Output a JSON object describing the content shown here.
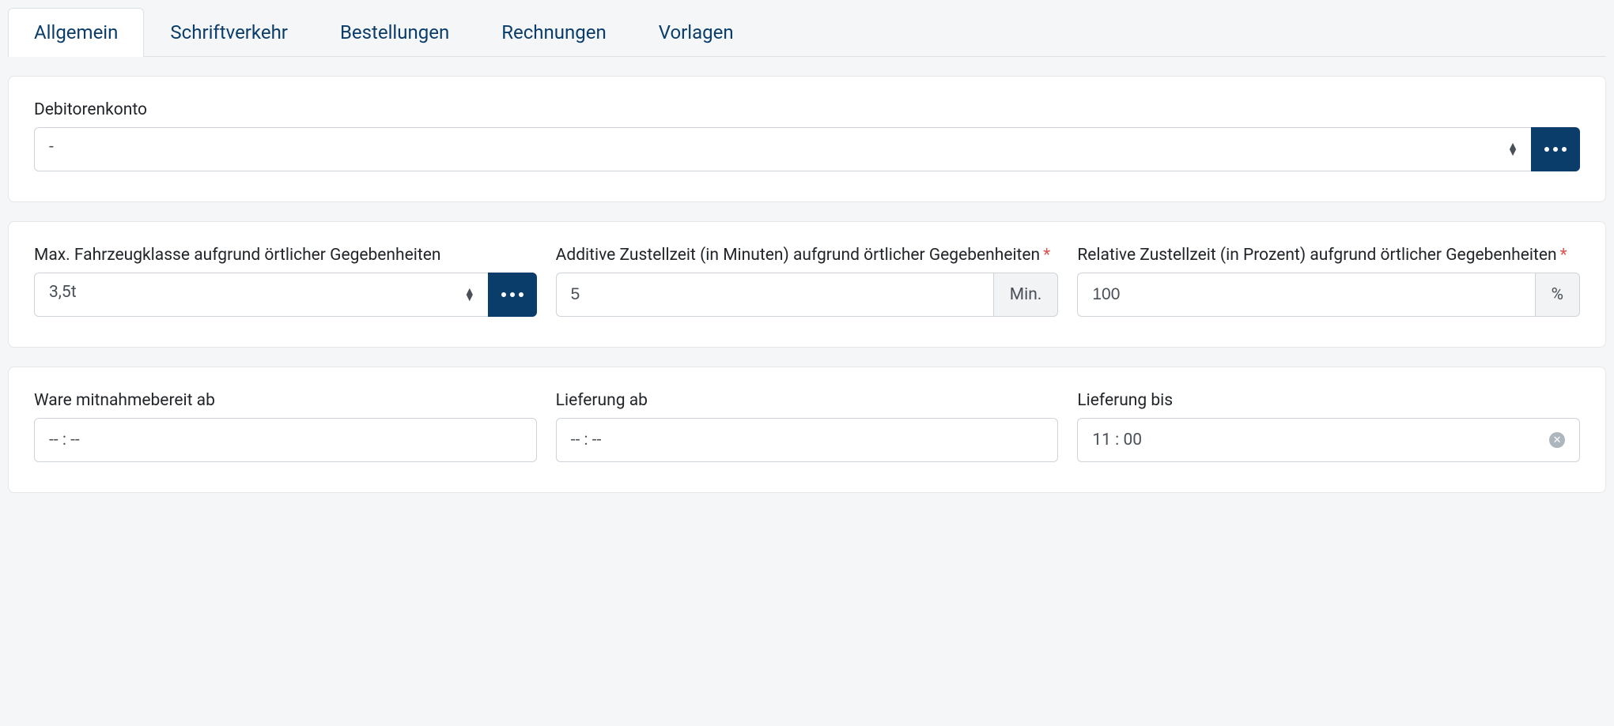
{
  "tabs": [
    {
      "label": "Allgemein",
      "active": true
    },
    {
      "label": "Schriftverkehr",
      "active": false
    },
    {
      "label": "Bestellungen",
      "active": false
    },
    {
      "label": "Rechnungen",
      "active": false
    },
    {
      "label": "Vorlagen",
      "active": false
    }
  ],
  "card1": {
    "debitor_label": "Debitorenkonto",
    "debitor_value": "-"
  },
  "card2": {
    "vehicle_label": "Max. Fahrzeugklasse aufgrund örtlicher Gegebenheiten",
    "vehicle_value": "3,5t",
    "additive_label": "Additive Zustellzeit (in Minuten) aufgrund örtlicher Gegebenheiten",
    "additive_value": "5",
    "additive_suffix": "Min.",
    "relative_label": "Relative Zustellzeit (in Prozent) aufgrund örtlicher Gegebenheiten",
    "relative_value": "100",
    "relative_suffix": "%"
  },
  "card3": {
    "ready_label": "Ware mitnahmebereit ab",
    "ready_value": "-- : --",
    "from_label": "Lieferung ab",
    "from_value": "-- : --",
    "until_label": "Lieferung bis",
    "until_value": "11 : 00"
  },
  "required_mark": "*"
}
